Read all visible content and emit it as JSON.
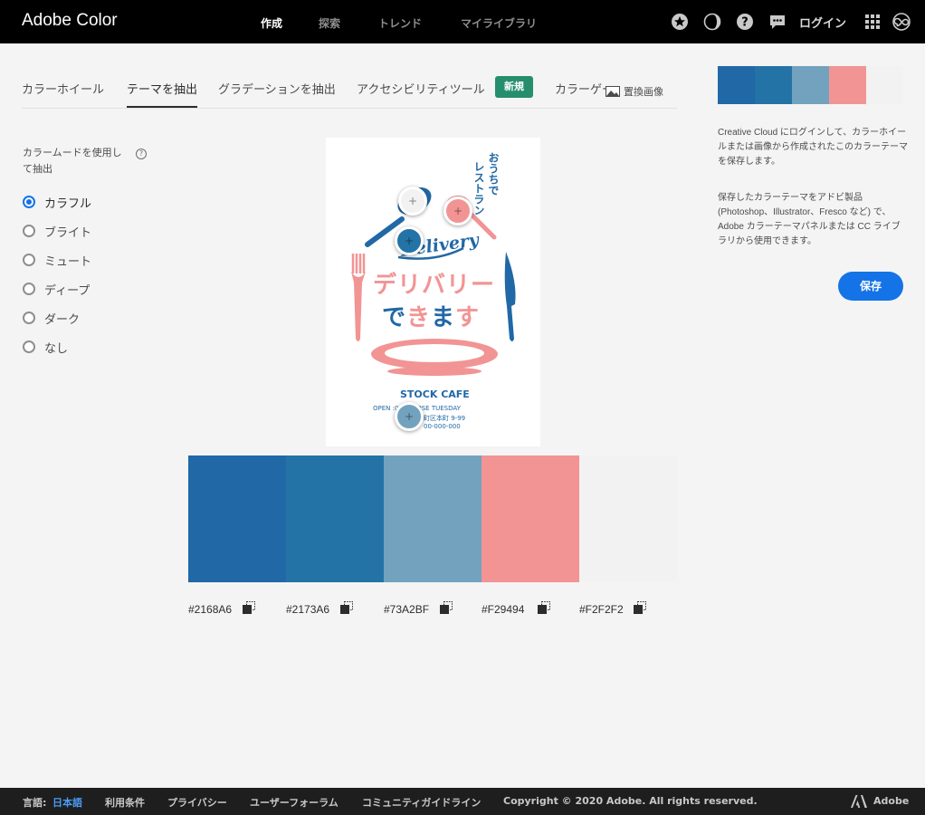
{
  "header": {
    "brand": "Adobe Color",
    "nav": [
      "作成",
      "探索",
      "トレンド",
      "マイライブラリ"
    ],
    "login": "ログイン",
    "icons": [
      "star-icon",
      "contrast-icon",
      "help-icon",
      "chat-icon",
      "apps-grid-icon",
      "creative-cloud-icon"
    ]
  },
  "tabs": {
    "items": [
      "カラーホイール",
      "テーマを抽出",
      "グラデーションを抽出",
      "アクセシビリティツール",
      "カラーゲーム"
    ],
    "new_badge": "新規",
    "replace_image": "置換画像"
  },
  "mood": {
    "title": "カラームードを使用して抽出",
    "help": "?",
    "options": [
      "カラフル",
      "ブライト",
      "ミュート",
      "ディープ",
      "ダーク",
      "なし"
    ],
    "selected": "カラフル"
  },
  "poster": {
    "vertical_line1": "おうちで",
    "vertical_line2": "レストラン",
    "script_word": "Delivery",
    "headline1": "デリバリー",
    "headline2_a": "で",
    "headline2_b": "き",
    "headline2_c": "ま",
    "headline2_d": "す",
    "cafe": "STOCK CAFE",
    "hours": "OPEN    :00 / CLOSE    TUESDAY",
    "address": "町区本町 9-99",
    "phone": "00-000-000"
  },
  "theme": {
    "swatches": [
      {
        "hex": "#2168A6",
        "color": "#2168a6"
      },
      {
        "hex": "#2173A6",
        "color": "#2473a6"
      },
      {
        "hex": "#73A2BF",
        "color": "#73a2bf"
      },
      {
        "hex": "#F29494",
        "color": "#f29494"
      },
      {
        "hex": "#F2F2F2",
        "color": "#f2f2f2"
      }
    ]
  },
  "sidebar": {
    "info1": "Creative Cloud にログインして、カラーホイールまたは画像から作成されたこのカラーテーマを保存します。",
    "info2": "保存したカラーテーマをアドビ製品 (Photoshop、Illustrator、Fresco など) で、Adobe カラーテーマパネルまたは CC ライブラリから使用できます。",
    "save": "保存"
  },
  "footer": {
    "lang_label": "言語:",
    "lang_value": "日本語",
    "links": [
      "利用条件",
      "プライバシー",
      "ユーザーフォーラム",
      "コミュニティガイドライン"
    ],
    "copyright": "Copyright © 2020 Adobe. All rights reserved.",
    "adobe": "Adobe"
  }
}
